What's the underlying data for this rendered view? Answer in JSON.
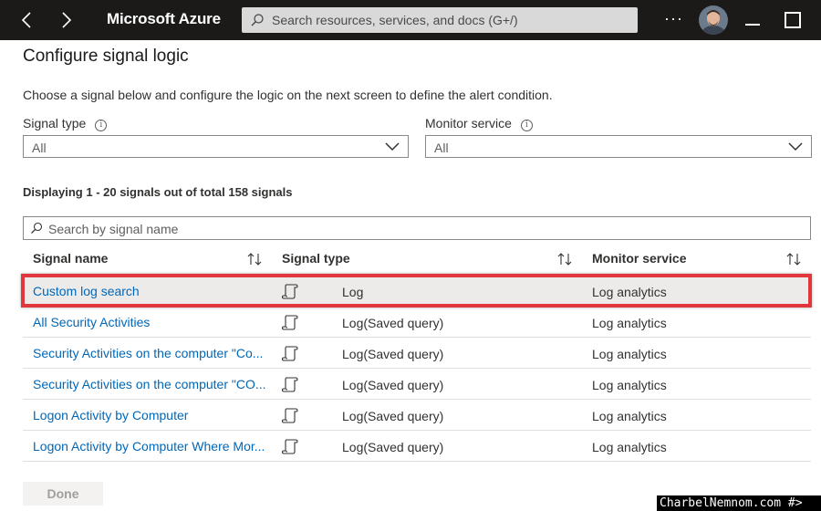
{
  "topbar": {
    "brand": "Microsoft Azure",
    "search_placeholder": "Search resources, services, and docs (G+/)",
    "more_label": "···"
  },
  "page": {
    "title": "Configure signal logic",
    "description": "Choose a signal below and configure the logic on the next screen to define the alert condition."
  },
  "filters": {
    "signal_type": {
      "label": "Signal type",
      "value": "All"
    },
    "monitor_service": {
      "label": "Monitor service",
      "value": "All"
    }
  },
  "count_text": "Displaying 1 - 20 signals out of total 158 signals",
  "signal_search": {
    "placeholder": "Search by signal name"
  },
  "table": {
    "columns": [
      "Signal name",
      "Signal type",
      "Monitor service"
    ],
    "rows": [
      {
        "name": "Custom log search",
        "type": "Log",
        "service": "Log analytics"
      },
      {
        "name": "All Security Activities",
        "type": "Log(Saved query)",
        "service": "Log analytics"
      },
      {
        "name": "Security Activities on the computer \"Co...",
        "type": "Log(Saved query)",
        "service": "Log analytics"
      },
      {
        "name": "Security Activities on the computer \"CO...",
        "type": "Log(Saved query)",
        "service": "Log analytics"
      },
      {
        "name": "Logon Activity by Computer",
        "type": "Log(Saved query)",
        "service": "Log analytics"
      },
      {
        "name": "Logon Activity by Computer Where Mor...",
        "type": "Log(Saved query)",
        "service": "Log analytics"
      }
    ]
  },
  "footer": {
    "done_label": "Done"
  },
  "watermark": "CharbelNemnom.com #>",
  "colors": {
    "topbar": "#1b1a19",
    "link": "#0067b8",
    "highlight": "#e0363c",
    "selected_row": "#edebe9"
  },
  "icons": {
    "back": "chevron-left-icon",
    "forward": "chevron-right-icon",
    "search": "search-icon",
    "info": "info-icon",
    "dropdown": "chevron-down-icon",
    "sort": "sort-icon",
    "log": "scroll-icon"
  }
}
